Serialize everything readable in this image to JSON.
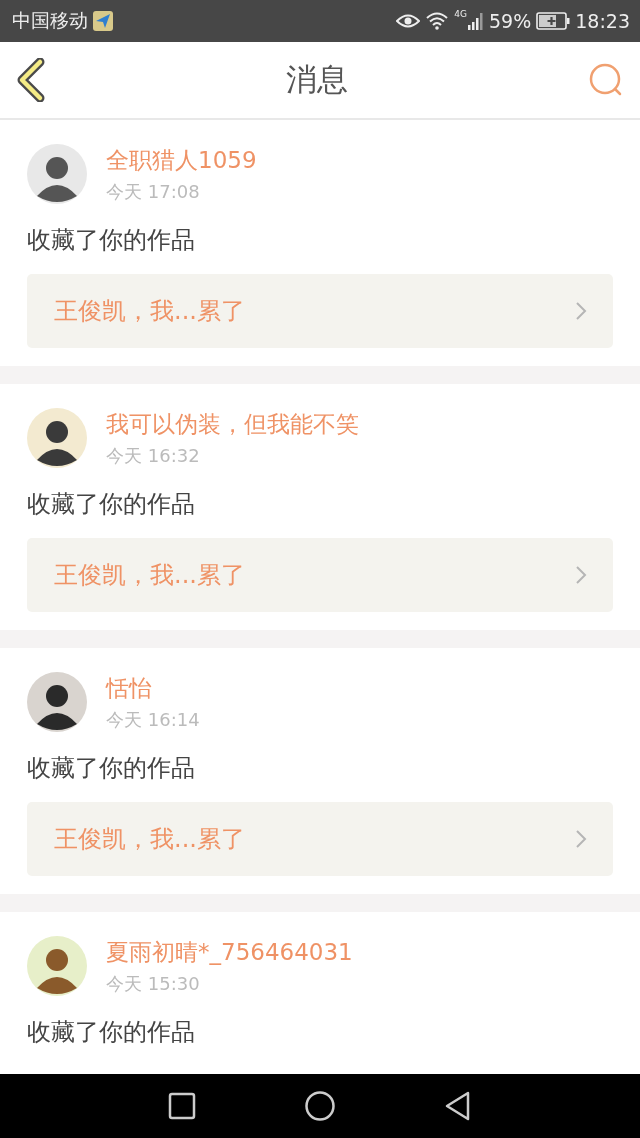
{
  "status_bar": {
    "carrier": "中国移动",
    "network": "4G",
    "battery": "59%",
    "time": "18:23"
  },
  "header": {
    "title": "消息"
  },
  "messages": [
    {
      "user": "全职猎人1059",
      "time": "今天 17:08",
      "action": "收藏了你的作品",
      "work": "王俊凯，我...累了"
    },
    {
      "user": "我可以伪装，但我能不笑",
      "time": "今天 16:32",
      "action": "收藏了你的作品",
      "work": "王俊凯，我...累了"
    },
    {
      "user": "恬怡",
      "time": "今天 16:14",
      "action": "收藏了你的作品",
      "work": "王俊凯，我...累了"
    },
    {
      "user": "夏雨初晴*_756464031",
      "time": "今天 15:30",
      "action": "收藏了你的作品"
    }
  ]
}
